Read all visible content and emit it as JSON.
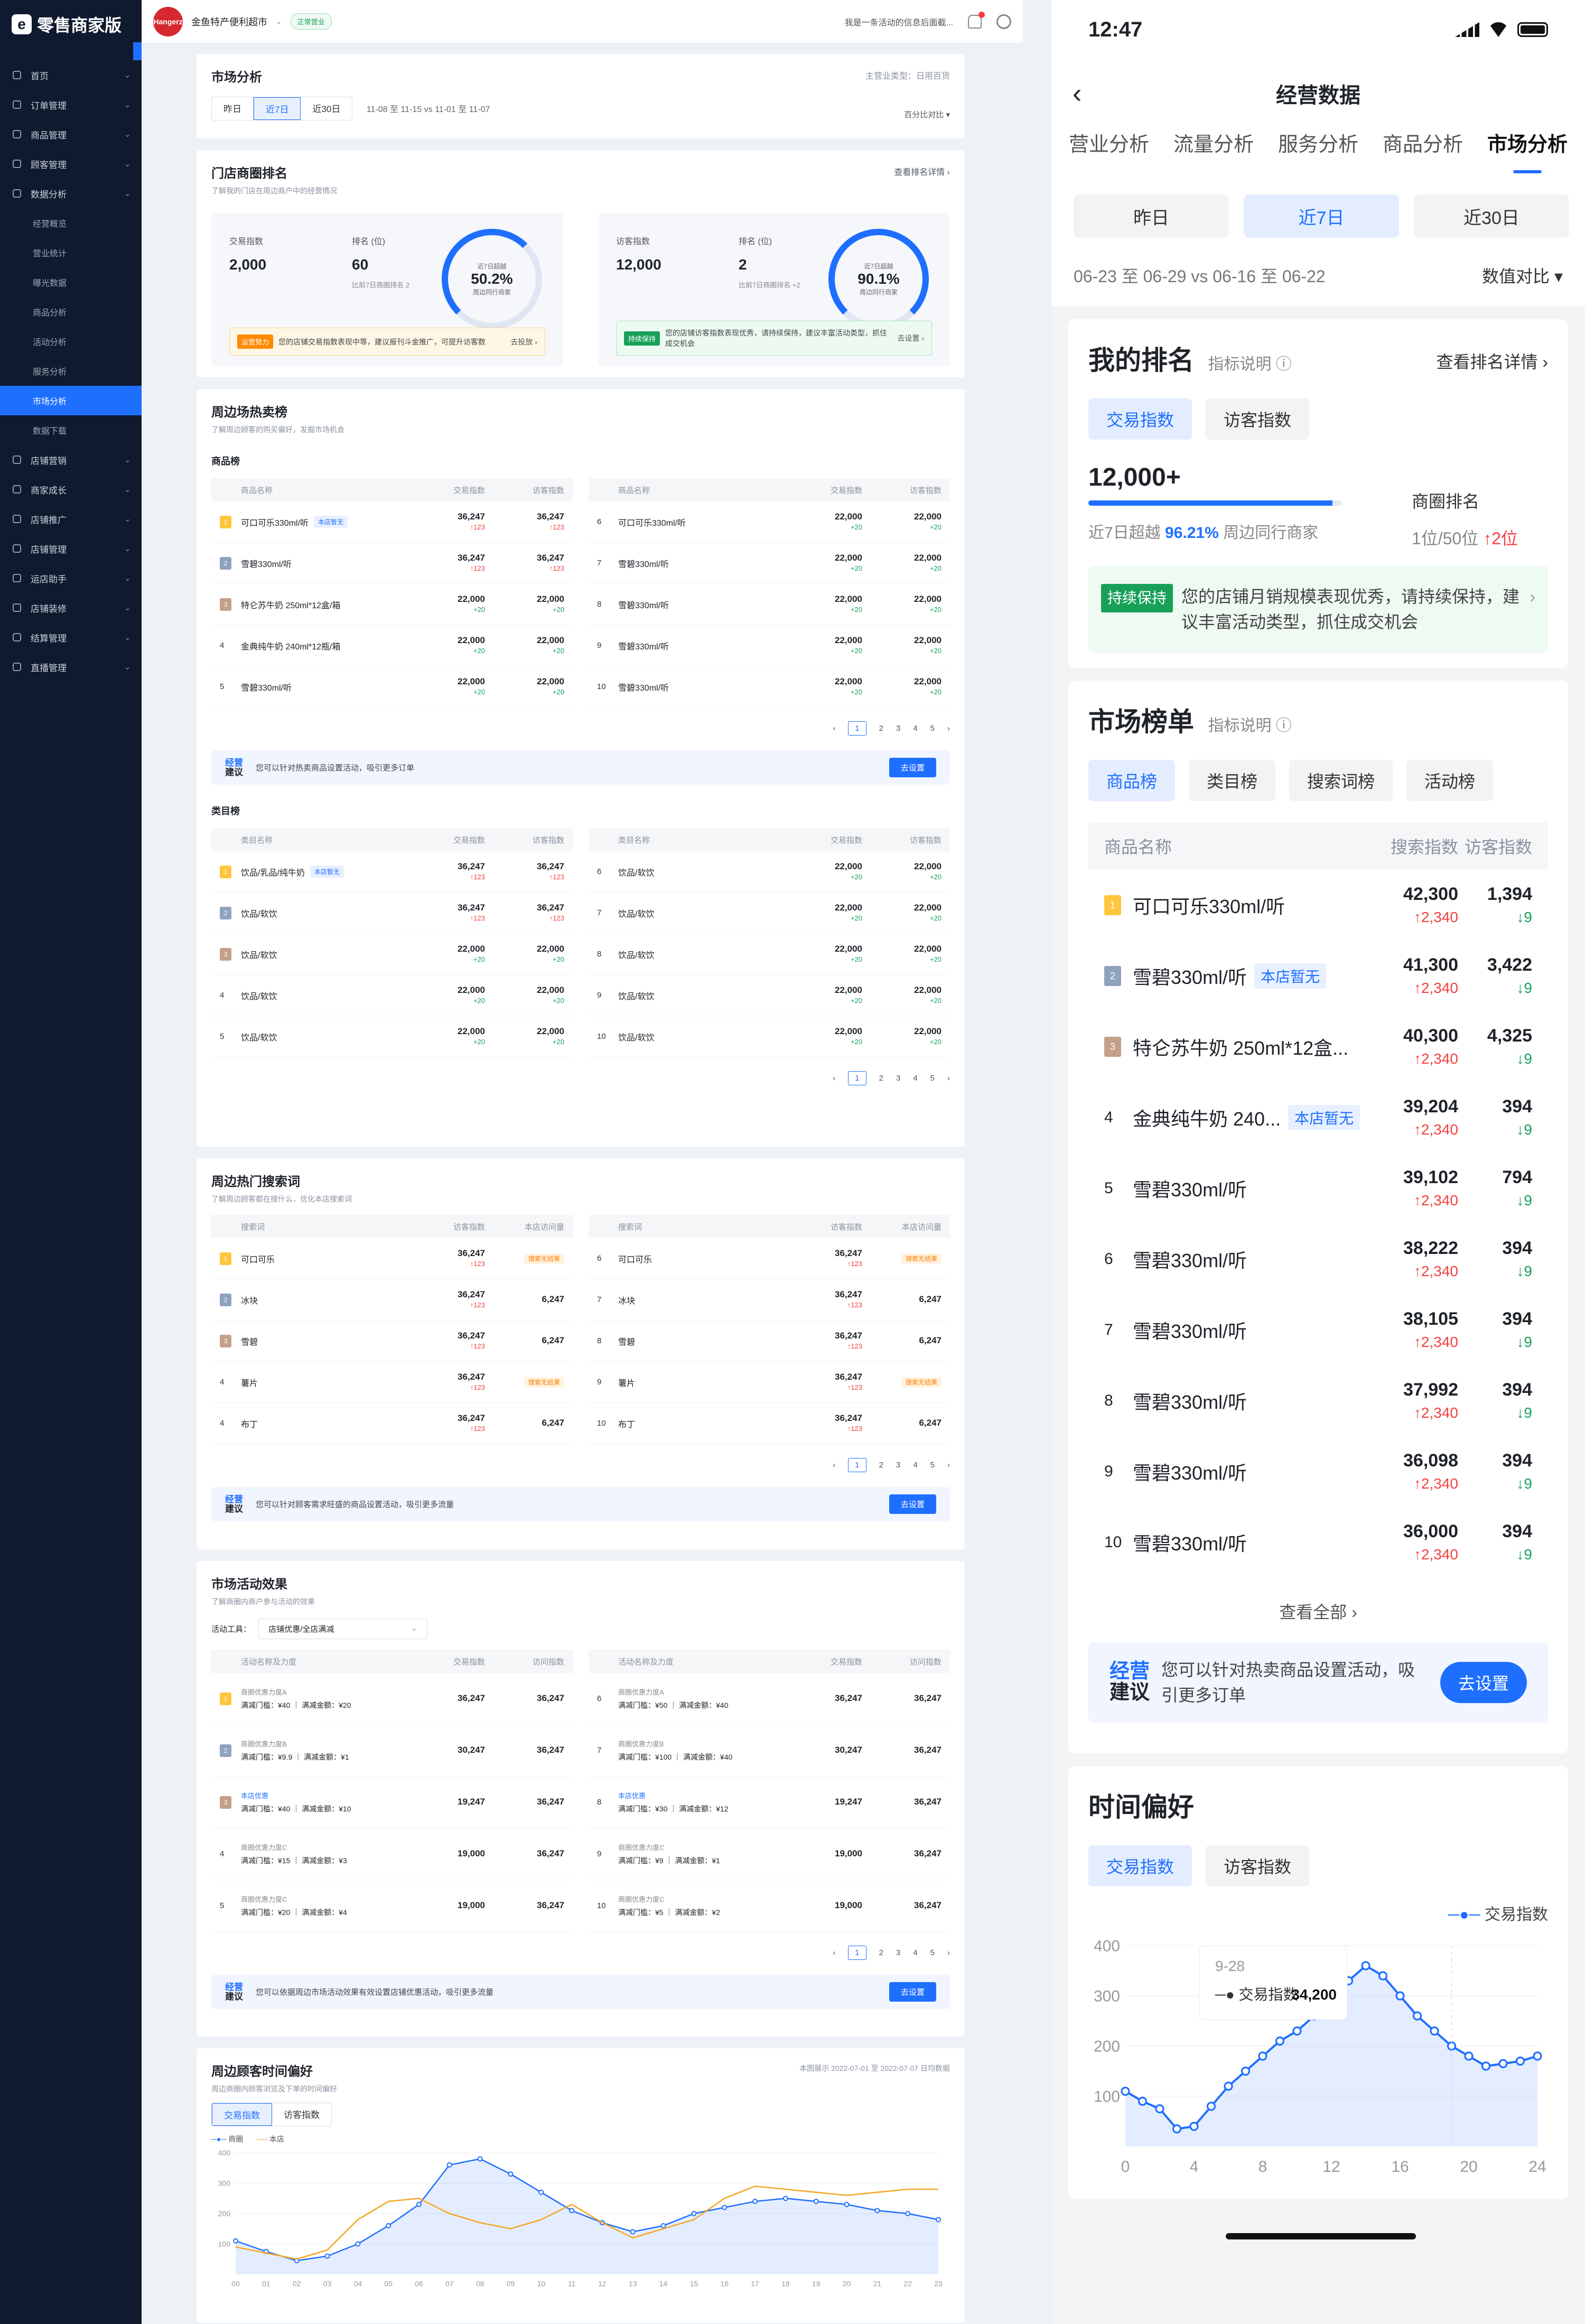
{
  "sidebar": {
    "app_title": "零售商家版",
    "items": [
      {
        "label": "首页",
        "icon": "home-icon"
      },
      {
        "label": "订单管理",
        "icon": "order-icon"
      },
      {
        "label": "商品管理",
        "icon": "goods-icon"
      },
      {
        "label": "顾客管理",
        "icon": "customer-icon"
      },
      {
        "label": "数据分析",
        "icon": "chart-icon"
      }
    ],
    "subitems": [
      "经营概览",
      "营业统计",
      "曝光数据",
      "商品分析",
      "活动分析",
      "服务分析",
      "市场分析",
      "数据下载"
    ],
    "active_sub": "市场分析",
    "items2": [
      "店铺营销",
      "商家成长",
      "店铺推广",
      "店铺管理",
      "运店助手",
      "店铺装修",
      "结算管理",
      "直播管理"
    ]
  },
  "topbar": {
    "store_logo_text": "Hangerz",
    "store_name": "金鱼特产便利超市",
    "status": "正常营业",
    "notice": "我是一条活动的信息后面截..."
  },
  "market": {
    "title": "市场分析",
    "industry": "主营业类型：日用百货",
    "periods": [
      "昨日",
      "近7日",
      "近30日"
    ],
    "range": "11-08 至 11-15 vs 11-01 至 11-07",
    "compare": "百分比对比"
  },
  "store_rank": {
    "title": "门店商圈排名",
    "desc": "了解我的门店在周边商户中的经营情况",
    "link": "查看排名详情",
    "trade": {
      "label": "交易指数",
      "value": "2,000",
      "rank_label": "排名 (位)",
      "rank": "60",
      "ring_label": "近7日超越",
      "ring_value": "50.2%",
      "ring_foot": "周边同行商家",
      "rank_note": "比前7日商圈排名 2",
      "tag": "运营努力",
      "tip": "您的店铺交易指数表现中等，建议报刊斗金推广，可提升访客数",
      "tip_link": "报刊斗金推广",
      "go": "去投放"
    },
    "visitor": {
      "label": "访客指数",
      "value": "12,000",
      "rank_label": "排名 (位)",
      "rank": "2",
      "ring_label": "近7日超越",
      "ring_value": "90.1%",
      "ring_foot": "周边同行商家",
      "rank_note": "比前7日商圈排名 +2",
      "tag": "持续保持",
      "tip": "您的店铺访客指数表现优秀，请持续保持，建议丰富活动类型，抓住成交机会",
      "tip_link": "丰富活动类型",
      "go": "去设置"
    }
  },
  "hot": {
    "title": "周边场热卖榜",
    "desc": "了解周边顾客的购买偏好，发掘市场机会",
    "goods_title": "商品榜",
    "goods_headers": [
      "商品名称",
      "交易指数",
      "访客指数"
    ],
    "goods_left": [
      {
        "rank": "1",
        "name": "可口可乐330ml/听",
        "chip": "本店暂无",
        "v1": "36,247",
        "d1": "↑123",
        "v2": "36,247",
        "d2": "↑123"
      },
      {
        "rank": "2",
        "name": "雪碧330ml/听",
        "chip": "",
        "v1": "36,247",
        "d1": "↑123",
        "v2": "36,247",
        "d2": "↑123"
      },
      {
        "rank": "3",
        "name": "特仑苏牛奶 250ml*12盒/箱",
        "chip": "",
        "v1": "22,000",
        "d1": "+20",
        "v2": "22,000",
        "d2": "+20"
      },
      {
        "rank": "4",
        "name": "金典纯牛奶 240ml*12瓶/箱",
        "chip": "",
        "v1": "22,000",
        "d1": "+20",
        "v2": "22,000",
        "d2": "+20"
      },
      {
        "rank": "5",
        "name": "雪碧330ml/听",
        "chip": "",
        "v1": "22,000",
        "d1": "+20",
        "v2": "22,000",
        "d2": "+20"
      }
    ],
    "goods_right": [
      {
        "rank": "6",
        "name": "可口可乐330ml/听",
        "v1": "22,000",
        "d1": "+20",
        "v2": "22,000",
        "d2": "+20"
      },
      {
        "rank": "7",
        "name": "雪碧330ml/听",
        "v1": "22,000",
        "d1": "+20",
        "v2": "22,000",
        "d2": "+20"
      },
      {
        "rank": "8",
        "name": "雪碧330ml/听",
        "v1": "22,000",
        "d1": "+20",
        "v2": "22,000",
        "d2": "+20"
      },
      {
        "rank": "9",
        "name": "雪碧330ml/听",
        "v1": "22,000",
        "d1": "+20",
        "v2": "22,000",
        "d2": "+20"
      },
      {
        "rank": "10",
        "name": "雪碧330ml/听",
        "v1": "22,000",
        "d1": "+20",
        "v2": "22,000",
        "d2": "+20"
      }
    ],
    "pages": [
      "1",
      "2",
      "3",
      "4",
      "5"
    ],
    "advice_label1": "经营",
    "advice_label2": "建议",
    "advice": "您可以针对热卖商品设置活动，吸引更多订单",
    "advice_link": "设置活动",
    "advice_btn": "去设置",
    "cat_title": "类目榜",
    "cat_headers": [
      "类目名称",
      "交易指数",
      "访客指数"
    ],
    "cat_left": [
      {
        "rank": "1",
        "name": "饮品/乳品/纯牛奶",
        "chip": "本店暂无",
        "v1": "36,247",
        "d1": "↑123",
        "v2": "36,247",
        "d2": "↑123"
      },
      {
        "rank": "2",
        "name": "饮品/软饮",
        "chip": "",
        "v1": "36,247",
        "d1": "↑123",
        "v2": "36,247",
        "d2": "↑123"
      },
      {
        "rank": "3",
        "name": "饮品/软饮",
        "chip": "",
        "v1": "22,000",
        "d1": "+20",
        "v2": "22,000",
        "d2": "+20"
      },
      {
        "rank": "4",
        "name": "饮品/软饮",
        "chip": "",
        "v1": "22,000",
        "d1": "+20",
        "v2": "22,000",
        "d2": "+20"
      },
      {
        "rank": "5",
        "name": "饮品/软饮",
        "chip": "",
        "v1": "22,000",
        "d1": "+20",
        "v2": "22,000",
        "d2": "+20"
      }
    ],
    "cat_right": [
      {
        "rank": "6",
        "name": "饮品/软饮",
        "v1": "22,000",
        "d1": "+20",
        "v2": "22,000",
        "d2": "+20"
      },
      {
        "rank": "7",
        "name": "饮品/软饮",
        "v1": "22,000",
        "d1": "+20",
        "v2": "22,000",
        "d2": "+20"
      },
      {
        "rank": "8",
        "name": "饮品/软饮",
        "v1": "22,000",
        "d1": "+20",
        "v2": "22,000",
        "d2": "+20"
      },
      {
        "rank": "9",
        "name": "饮品/软饮",
        "v1": "22,000",
        "d1": "+20",
        "v2": "22,000",
        "d2": "+20"
      },
      {
        "rank": "10",
        "name": "饮品/软饮",
        "v1": "22,000",
        "d1": "+20",
        "v2": "22,000",
        "d2": "+20"
      }
    ]
  },
  "search": {
    "title": "周边热门搜索词",
    "desc": "了解周边顾客都在搜什么，优化本店搜索词",
    "headers": [
      "搜索词",
      "访客指数",
      "本店访问量"
    ],
    "left": [
      {
        "rank": "1",
        "name": "可口可乐",
        "v1": "36,247",
        "d1": "↑123",
        "v2": "搜索无结果"
      },
      {
        "rank": "2",
        "name": "冰块",
        "v1": "36,247",
        "d1": "↑123",
        "v2": "6,247"
      },
      {
        "rank": "3",
        "name": "雪碧",
        "v1": "36,247",
        "d1": "↑123",
        "v2": "6,247"
      },
      {
        "rank": "4",
        "name": "薯片",
        "v1": "36,247",
        "d1": "↑123",
        "v2": "搜索无结果"
      },
      {
        "rank": "4",
        "name": "布丁",
        "v1": "36,247",
        "d1": "↑123",
        "v2": "6,247"
      }
    ],
    "right": [
      {
        "rank": "6",
        "name": "可口可乐",
        "v1": "36,247",
        "d1": "↑123",
        "v2": "搜索无结果"
      },
      {
        "rank": "7",
        "name": "冰块",
        "v1": "36,247",
        "d1": "↑123",
        "v2": "6,247"
      },
      {
        "rank": "8",
        "name": "雪碧",
        "v1": "36,247",
        "d1": "↑123",
        "v2": "6,247"
      },
      {
        "rank": "9",
        "name": "薯片",
        "v1": "36,247",
        "d1": "↑123",
        "v2": "搜索无结果"
      },
      {
        "rank": "10",
        "name": "布丁",
        "v1": "36,247",
        "d1": "↑123",
        "v2": "6,247"
      }
    ],
    "advice": "您可以针对顾客需求旺盛的商品设置活动，吸引更多流量",
    "advice_link": "设置活动",
    "advice_btn": "去设置"
  },
  "activity": {
    "title": "市场活动效果",
    "desc": "了解商圈内商户参与活动的效果",
    "tool_label": "活动工具：",
    "tool_value": "店铺优惠/全店满减",
    "headers": [
      "活动名称及力度",
      "交易指数",
      "访问指数"
    ],
    "left": [
      {
        "rank": "1",
        "name": "商圈优惠力度A",
        "detail": "满减门槛：¥40 ｜ 满减金额：¥20",
        "v1": "36,247",
        "v2": "36,247"
      },
      {
        "rank": "2",
        "name": "商圈优惠力度B",
        "detail": "满减门槛：¥9.9 ｜ 满减金额：¥1",
        "v1": "30,247",
        "v2": "36,247"
      },
      {
        "rank": "3",
        "name": "本店优惠",
        "detail": "满减门槛：¥40 ｜ 满减金额：¥10",
        "v1": "19,247",
        "v2": "36,247"
      },
      {
        "rank": "4",
        "name": "商圈优惠力度C",
        "detail": "满减门槛：¥15 ｜ 满减金额：¥3",
        "v1": "19,000",
        "v2": "36,247"
      },
      {
        "rank": "5",
        "name": "商圈优惠力度C",
        "detail": "满减门槛：¥20 ｜ 满减金额：¥4",
        "v1": "19,000",
        "v2": "36,247"
      }
    ],
    "right": [
      {
        "rank": "6",
        "name": "商圈优惠力度A",
        "detail": "满减门槛：¥50 ｜ 满减金额：¥40",
        "v1": "36,247",
        "v2": "36,247"
      },
      {
        "rank": "7",
        "name": "商圈优惠力度B",
        "detail": "满减门槛：¥100 ｜ 满减金额：¥40",
        "v1": "30,247",
        "v2": "36,247"
      },
      {
        "rank": "8",
        "name": "本店优惠",
        "detail": "满减门槛：¥30 ｜ 满减金额：¥12",
        "v1": "19,247",
        "v2": "36,247"
      },
      {
        "rank": "9",
        "name": "商圈优惠力度C",
        "detail": "满减门槛：¥9 ｜ 满减金额：¥1",
        "v1": "19,000",
        "v2": "36,247"
      },
      {
        "rank": "10",
        "name": "商圈优惠力度C",
        "detail": "满减门槛：¥5 ｜ 满减金额：¥2",
        "v1": "19,000",
        "v2": "36,247"
      }
    ],
    "advice": "您可以依据周边市场活动效果有效设置店铺优惠活动，吸引更多流量",
    "advice_link": "设置店铺优惠活动",
    "advice_btn": "去设置"
  },
  "timepref": {
    "title": "周边顾客时间偏好",
    "desc": "周边商圈内顾客浏览及下单的时间偏好",
    "note": "本图展示 2022-07-01 至 2022-07-07 日均数据",
    "pills": [
      "交易指数",
      "访客指数"
    ],
    "legend": [
      "商圈",
      "本店"
    ]
  },
  "chart_data": [
    {
      "type": "line",
      "x": [
        "00",
        "01",
        "02",
        "03",
        "04",
        "05",
        "06",
        "07",
        "08",
        "09",
        "10",
        "11",
        "12",
        "13",
        "14",
        "15",
        "16",
        "17",
        "18",
        "19",
        "20",
        "21",
        "22",
        "23"
      ],
      "ylim": [
        0,
        400
      ],
      "yticks": [
        100,
        200,
        300,
        400
      ],
      "series": [
        {
          "name": "商圈",
          "values": [
            110,
            75,
            45,
            60,
            100,
            160,
            230,
            360,
            380,
            330,
            270,
            210,
            170,
            140,
            160,
            200,
            220,
            240,
            250,
            240,
            230,
            210,
            200,
            180
          ]
        },
        {
          "name": "本店",
          "values": [
            90,
            70,
            50,
            80,
            180,
            240,
            250,
            200,
            170,
            150,
            180,
            230,
            170,
            120,
            150,
            180,
            250,
            290,
            280,
            270,
            260,
            270,
            280,
            280
          ]
        }
      ]
    },
    {
      "type": "line",
      "x": [
        0,
        1,
        2,
        3,
        4,
        5,
        6,
        7,
        8,
        9,
        10,
        11,
        12,
        13,
        14,
        15,
        16,
        17,
        18,
        19,
        20,
        21,
        22,
        23,
        24
      ],
      "xticks": [
        0,
        4,
        8,
        12,
        16,
        20,
        24
      ],
      "ylim": [
        0,
        400
      ],
      "yticks": [
        100,
        200,
        300,
        400
      ],
      "series": [
        {
          "name": "交易指数",
          "values": [
            110,
            90,
            75,
            35,
            40,
            80,
            120,
            150,
            180,
            210,
            230,
            260,
            290,
            330,
            360,
            340,
            300,
            260,
            230,
            200,
            180,
            160,
            165,
            170,
            180
          ]
        }
      ],
      "tooltip": {
        "date": "9-28",
        "label": "交易指数",
        "value": "34,200"
      }
    }
  ],
  "phone": {
    "time": "12:47",
    "title": "经营数据",
    "tabs": [
      "营业分析",
      "流量分析",
      "服务分析",
      "商品分析",
      "市场分析"
    ],
    "periods": [
      "昨日",
      "近7日",
      "近30日"
    ],
    "range": "06-23 至 06-29  vs  06-16 至 06-22",
    "compare": "数值对比",
    "my_rank": {
      "title": "我的排名",
      "exp": "指标说明",
      "link": "查看排名详情",
      "pills": [
        "交易指数",
        "访客指数"
      ],
      "value": "12,000+",
      "progress": 0.9621,
      "beat_pre": "近7日超越",
      "beat": "96.21%",
      "beat_post": "周边同行商家",
      "rank_label": "商圈排名",
      "rank": "1位/50位",
      "rank_change": "↑2位",
      "tag": "持续保持",
      "tip": "您的店铺月销规模表现优秀，请持续保持，建议丰富活动类型，抓住成交机会",
      "tip_link": "丰富活动类型"
    },
    "board": {
      "title": "市场榜单",
      "exp": "指标说明",
      "pills": [
        "商品榜",
        "类目榜",
        "搜索词榜",
        "活动榜"
      ],
      "headers": [
        "商品名称",
        "搜索指数",
        "访客指数"
      ],
      "rows": [
        {
          "rank": "1",
          "name": "可口可乐330ml/听",
          "chip": "",
          "v1": "42,300",
          "d1": "↑2,340",
          "v2": "1,394",
          "d2": "↓9"
        },
        {
          "rank": "2",
          "name": "雪碧330ml/听",
          "chip": "本店暂无",
          "v1": "41,300",
          "d1": "↑2,340",
          "v2": "3,422",
          "d2": "↓9"
        },
        {
          "rank": "3",
          "name": "特仑苏牛奶 250ml*12盒...",
          "chip": "",
          "v1": "40,300",
          "d1": "↑2,340",
          "v2": "4,325",
          "d2": "↓9"
        },
        {
          "rank": "4",
          "name": "金典纯牛奶 240...",
          "chip": "本店暂无",
          "v1": "39,204",
          "d1": "↑2,340",
          "v2": "394",
          "d2": "↓9"
        },
        {
          "rank": "5",
          "name": "雪碧330ml/听",
          "chip": "",
          "v1": "39,102",
          "d1": "↑2,340",
          "v2": "794",
          "d2": "↓9"
        },
        {
          "rank": "6",
          "name": "雪碧330ml/听",
          "chip": "",
          "v1": "38,222",
          "d1": "↑2,340",
          "v2": "394",
          "d2": "↓9"
        },
        {
          "rank": "7",
          "name": "雪碧330ml/听",
          "chip": "",
          "v1": "38,105",
          "d1": "↑2,340",
          "v2": "394",
          "d2": "↓9"
        },
        {
          "rank": "8",
          "name": "雪碧330ml/听",
          "chip": "",
          "v1": "37,992",
          "d1": "↑2,340",
          "v2": "394",
          "d2": "↓9"
        },
        {
          "rank": "9",
          "name": "雪碧330ml/听",
          "chip": "",
          "v1": "36,098",
          "d1": "↑2,340",
          "v2": "394",
          "d2": "↓9"
        },
        {
          "rank": "10",
          "name": "雪碧330ml/听",
          "chip": "",
          "v1": "36,000",
          "d1": "↑2,340",
          "v2": "394",
          "d2": "↓9"
        }
      ],
      "all": "查看全部 ›",
      "advice_label1": "经营",
      "advice_label2": "建议",
      "advice": "您可以针对热卖商品设置活动，吸引更多订单",
      "advice_link": "设置活动",
      "advice_btn": "去设置"
    },
    "time_pref": {
      "title": "时间偏好",
      "pills": [
        "交易指数",
        "访客指数"
      ],
      "legend": "交易指数"
    }
  },
  "colors": {
    "primary": "#1f6fff",
    "sidebar": "#0f1a2e",
    "up": "#f53f3f",
    "down": "#18a058",
    "warn": "#ff8a00"
  }
}
